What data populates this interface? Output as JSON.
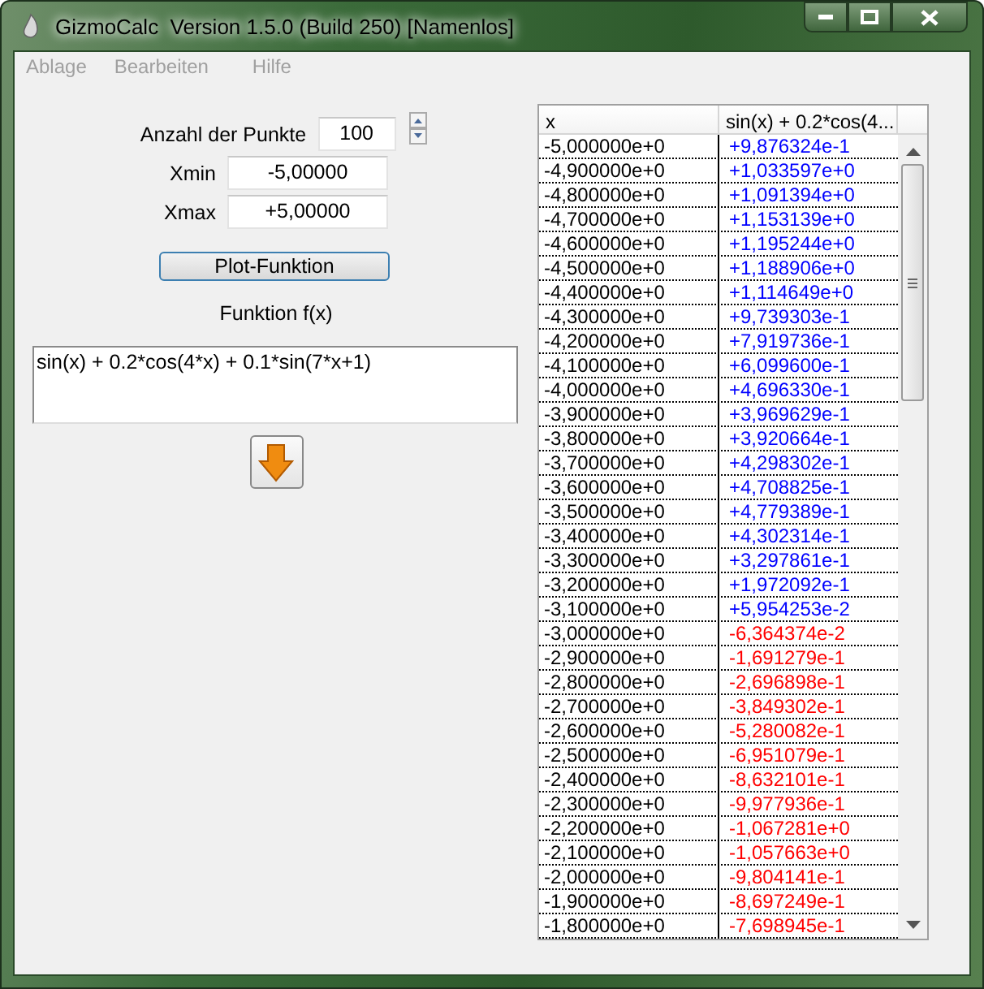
{
  "window": {
    "title": "GizmoCalc  Version 1.5.0 (Build 250) [Namenlos]"
  },
  "menu": [
    {
      "label": "Ablage",
      "disabled": true
    },
    {
      "label": "Bearbeiten",
      "disabled": true
    },
    {
      "label": "Hilfe",
      "disabled": true
    }
  ],
  "points": {
    "label": "Anzahl der Punkte",
    "value": "100"
  },
  "range": [
    {
      "label": "Xmin",
      "value": "-5,00000"
    },
    {
      "label": "Xmax",
      "value": "+5,00000"
    }
  ],
  "plot_button": "Plot-Funktion",
  "function_label": "Funktion f(x)",
  "function_input": {
    "value": "sin(x) + 0.2*cos(4*x) + 0.1*sin(7*x+1)"
  },
  "table": {
    "columns": [
      "x",
      "sin(x) + 0.2*cos(4..."
    ],
    "rows": [
      {
        "x": "-5,000000e+0",
        "y": "+9,876324e-1",
        "color": "#0000ff"
      },
      {
        "x": "-4,900000e+0",
        "y": "+1,033597e+0",
        "color": "#0000ff"
      },
      {
        "x": "-4,800000e+0",
        "y": "+1,091394e+0",
        "color": "#0000ff"
      },
      {
        "x": "-4,700000e+0",
        "y": "+1,153139e+0",
        "color": "#0000ff"
      },
      {
        "x": "-4,600000e+0",
        "y": "+1,195244e+0",
        "color": "#0000ff"
      },
      {
        "x": "-4,500000e+0",
        "y": "+1,188906e+0",
        "color": "#0000ff"
      },
      {
        "x": "-4,400000e+0",
        "y": "+1,114649e+0",
        "color": "#0000ff"
      },
      {
        "x": "-4,300000e+0",
        "y": "+9,739303e-1",
        "color": "#0000ff"
      },
      {
        "x": "-4,200000e+0",
        "y": "+7,919736e-1",
        "color": "#0000ff"
      },
      {
        "x": "-4,100000e+0",
        "y": "+6,099600e-1",
        "color": "#0000ff"
      },
      {
        "x": "-4,000000e+0",
        "y": "+4,696330e-1",
        "color": "#0000ff"
      },
      {
        "x": "-3,900000e+0",
        "y": "+3,969629e-1",
        "color": "#0000ff"
      },
      {
        "x": "-3,800000e+0",
        "y": "+3,920664e-1",
        "color": "#0000ff"
      },
      {
        "x": "-3,700000e+0",
        "y": "+4,298302e-1",
        "color": "#0000ff"
      },
      {
        "x": "-3,600000e+0",
        "y": "+4,708825e-1",
        "color": "#0000ff"
      },
      {
        "x": "-3,500000e+0",
        "y": "+4,779389e-1",
        "color": "#0000ff"
      },
      {
        "x": "-3,400000e+0",
        "y": "+4,302314e-1",
        "color": "#0000ff"
      },
      {
        "x": "-3,300000e+0",
        "y": "+3,297861e-1",
        "color": "#0000ff"
      },
      {
        "x": "-3,200000e+0",
        "y": "+1,972092e-1",
        "color": "#0000ff"
      },
      {
        "x": "-3,100000e+0",
        "y": "+5,954253e-2",
        "color": "#0000ff"
      },
      {
        "x": "-3,000000e+0",
        "y": "-6,364374e-2",
        "color": "#ff0000"
      },
      {
        "x": "-2,900000e+0",
        "y": "-1,691279e-1",
        "color": "#ff0000"
      },
      {
        "x": "-2,800000e+0",
        "y": "-2,696898e-1",
        "color": "#ff0000"
      },
      {
        "x": "-2,700000e+0",
        "y": "-3,849302e-1",
        "color": "#ff0000"
      },
      {
        "x": "-2,600000e+0",
        "y": "-5,280082e-1",
        "color": "#ff0000"
      },
      {
        "x": "-2,500000e+0",
        "y": "-6,951079e-1",
        "color": "#ff0000"
      },
      {
        "x": "-2,400000e+0",
        "y": "-8,632101e-1",
        "color": "#ff0000"
      },
      {
        "x": "-2,300000e+0",
        "y": "-9,977936e-1",
        "color": "#ff0000"
      },
      {
        "x": "-2,200000e+0",
        "y": "-1,067281e+0",
        "color": "#ff0000"
      },
      {
        "x": "-2,100000e+0",
        "y": "-1,057663e+0",
        "color": "#ff0000"
      },
      {
        "x": "-2,000000e+0",
        "y": "-9,804141e-1",
        "color": "#ff0000"
      },
      {
        "x": "-1,900000e+0",
        "y": "-8,697249e-1",
        "color": "#ff0000"
      },
      {
        "x": "-1,800000e+0",
        "y": "-7,698945e-1",
        "color": "#ff0000"
      }
    ]
  }
}
